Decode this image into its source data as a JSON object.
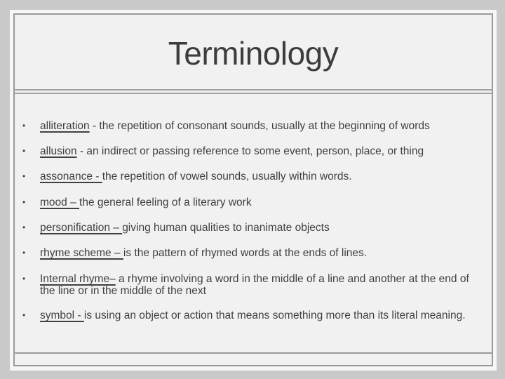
{
  "slide": {
    "title": "Terminology",
    "items": [
      {
        "term": "alliteration",
        "definition": " - the repetition of consonant sounds, usually at the beginning of words"
      },
      {
        "term": "allusion",
        "definition": " - an indirect or passing reference to some event, person, place, or thing"
      },
      {
        "term": "assonance - ",
        "definition": "the repetition of vowel sounds, usually within words."
      },
      {
        "term": "mood – ",
        "definition": "the general feeling of a literary work"
      },
      {
        "term": "personification – ",
        "definition": "giving human qualities to inanimate objects"
      },
      {
        "term": "rhyme scheme – ",
        "definition": "is the pattern of rhymed words at the ends of lines."
      },
      {
        "term": "Internal rhyme–",
        "definition": " a rhyme involving a word in the middle of a line and another at the end of the line or in the middle of the next"
      },
      {
        "term": "symbol - ",
        "definition": "is using an object or action that means something more than its literal meaning."
      }
    ],
    "bullet_char": "•"
  }
}
